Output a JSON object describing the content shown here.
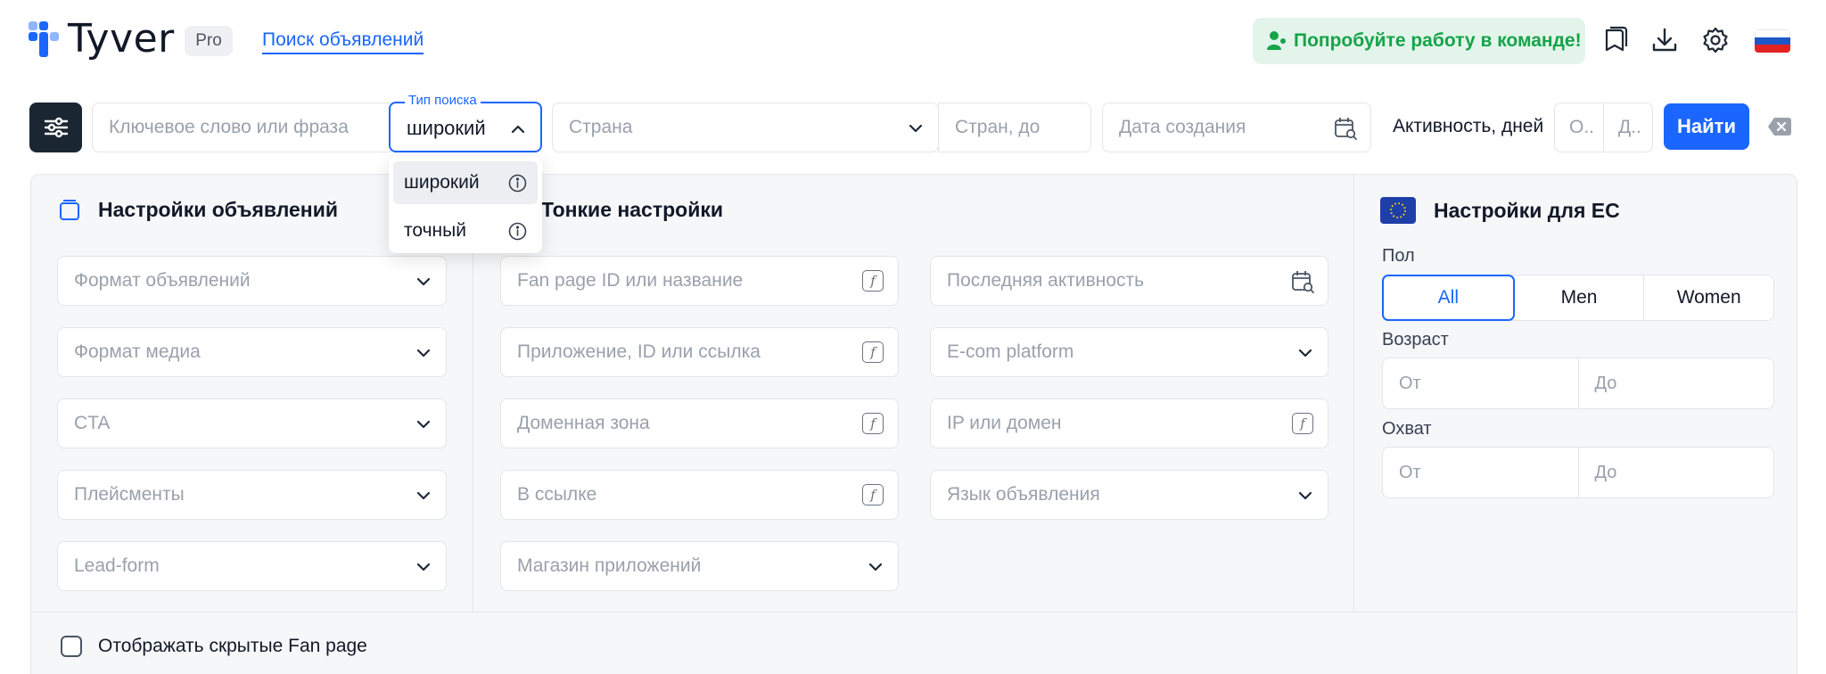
{
  "header": {
    "logo_text": "Tyver",
    "badge": "Pro",
    "nav_link": "Поиск объявлений",
    "team_button": "Попробуйте работу в команде!",
    "icons": [
      "book-icon",
      "download-icon",
      "gear-icon",
      "russia-flag-icon"
    ]
  },
  "search": {
    "keyword_placeholder": "Ключевое слово или фраза",
    "search_type_label": "Тип поиска",
    "search_type_value": "широкий",
    "country_placeholder": "Страна",
    "countries_to_placeholder": "Стран, до",
    "created_date_placeholder": "Дата создания",
    "activity_label": "Активность, дней",
    "activity_from_placeholder": "О..",
    "activity_to_placeholder": "Д..",
    "find_button": "Найти"
  },
  "dropdown": {
    "options": [
      {
        "label": "широкий",
        "selected": true
      },
      {
        "label": "точный",
        "selected": false
      }
    ]
  },
  "ad_settings": {
    "title": "Настройки объявлений",
    "fields": [
      "Формат объявлений",
      "Формат медиа",
      "CTA",
      "Плейсменты",
      "Lead-form"
    ]
  },
  "fine_settings": {
    "title": "Тонкие настройки",
    "left_fields": [
      "Fan page ID или название",
      "Приложение, ID или ссылка",
      "Доменная зона",
      "В ссылке",
      "Магазин приложений"
    ],
    "right_fields": [
      "Последняя активность",
      "E-com platform",
      "IP или домен",
      "Язык объявления"
    ]
  },
  "eu_settings": {
    "title": "Настройки для ЕС",
    "gender_label": "Пол",
    "gender_options": [
      "All",
      "Men",
      "Women"
    ],
    "gender_selected": "All",
    "age_label": "Возраст",
    "age_from": "От",
    "age_to": "До",
    "reach_label": "Охват",
    "reach_from": "От",
    "reach_to": "До"
  },
  "footer": {
    "hidden_fanpage_label": "Отображать скрытые Fan page",
    "hidden_fanpage_checked": false
  },
  "colors": {
    "accent": "#1a66ff",
    "dark_button": "#1b2633",
    "team_bg": "#e3f5ea",
    "team_text": "#16a34a"
  }
}
